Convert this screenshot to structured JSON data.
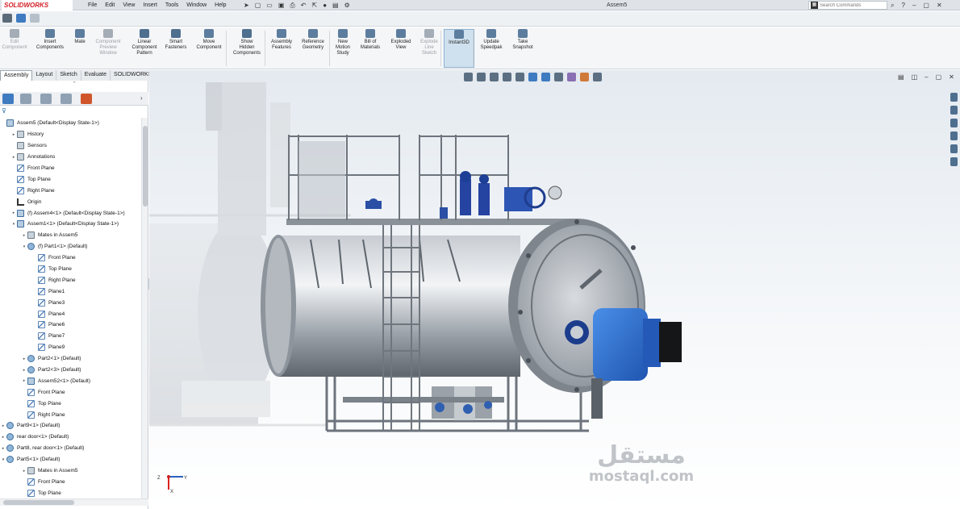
{
  "app": {
    "logo_text": "SOLIDWORKS",
    "window_title": "Assem5",
    "menu": [
      "File",
      "Edit",
      "View",
      "Insert",
      "Tools",
      "Window",
      "Help"
    ],
    "search_placeholder": "Search Commands"
  },
  "ribbon": {
    "buttons": [
      {
        "label": "Edit\nComponent",
        "enabled": false
      },
      {
        "label": "Insert\nComponents",
        "enabled": true
      },
      {
        "label": "Mate",
        "enabled": true
      },
      {
        "label": "Component\nPreview\nWindow",
        "enabled": false
      },
      {
        "label": "Linear\nComponent\nPattern",
        "enabled": true
      },
      {
        "label": "Smart\nFasteners",
        "enabled": true
      },
      {
        "label": "Move\nComponent",
        "enabled": true
      },
      {
        "label": "Show\nHidden\nComponents",
        "enabled": true
      },
      {
        "label": "Assembly\nFeatures",
        "enabled": true
      },
      {
        "label": "Reference\nGeometry",
        "enabled": true
      },
      {
        "label": "New\nMotion\nStudy",
        "enabled": true
      },
      {
        "label": "Bill of\nMaterials",
        "enabled": true
      },
      {
        "label": "Exploded\nView",
        "enabled": true
      },
      {
        "label": "Explode\nLine\nSketch",
        "enabled": false
      },
      {
        "label": "Instant3D",
        "enabled": true,
        "active": true
      },
      {
        "label": "Update\nSpeedpak",
        "enabled": true
      },
      {
        "label": "Take\nSnapshot",
        "enabled": true
      }
    ]
  },
  "tabs": [
    "Assembly",
    "Layout",
    "Sketch",
    "Evaluate",
    "SOLIDWORKS Add-Ins",
    "SOLIDWORKS MBD"
  ],
  "active_tab": "Assembly",
  "tree": [
    {
      "label": "Assem5  (Default<Display State-1>)",
      "icon": "assem",
      "indent": 0,
      "expander": ""
    },
    {
      "label": "History",
      "icon": "folder",
      "indent": 1,
      "expander": "▸"
    },
    {
      "label": "Sensors",
      "icon": "folder",
      "indent": 1,
      "expander": ""
    },
    {
      "label": "Annotations",
      "icon": "folder",
      "indent": 1,
      "expander": "▸"
    },
    {
      "label": "Front Plane",
      "icon": "plane",
      "indent": 1,
      "expander": ""
    },
    {
      "label": "Top Plane",
      "icon": "plane",
      "indent": 1,
      "expander": ""
    },
    {
      "label": "Right Plane",
      "icon": "plane",
      "indent": 1,
      "expander": ""
    },
    {
      "label": "Origin",
      "icon": "origin",
      "indent": 1,
      "expander": ""
    },
    {
      "label": "(f) Assem4<1> (Default<Display State-1>)",
      "icon": "assem",
      "indent": 1,
      "expander": "▸"
    },
    {
      "label": "Assem1<1> (Default<Display State-1>)",
      "icon": "assem",
      "indent": 1,
      "expander": "▾"
    },
    {
      "label": "Mates in Assem5",
      "icon": "folder",
      "indent": 2,
      "expander": "▸"
    },
    {
      "label": "(f) Part1<1> (Default)",
      "icon": "part",
      "indent": 2,
      "expander": "▾"
    },
    {
      "label": "Front Plane",
      "icon": "plane",
      "indent": 3,
      "expander": ""
    },
    {
      "label": "Top Plane",
      "icon": "plane",
      "indent": 3,
      "expander": ""
    },
    {
      "label": "Right Plane",
      "icon": "plane",
      "indent": 3,
      "expander": ""
    },
    {
      "label": "Plane1",
      "icon": "plane",
      "indent": 3,
      "expander": ""
    },
    {
      "label": "Plane3",
      "icon": "plane",
      "indent": 3,
      "expander": ""
    },
    {
      "label": "Plane4",
      "icon": "plane",
      "indent": 3,
      "expander": ""
    },
    {
      "label": "Plane6",
      "icon": "plane",
      "indent": 3,
      "expander": ""
    },
    {
      "label": "Plane7",
      "icon": "plane",
      "indent": 3,
      "expander": ""
    },
    {
      "label": "Plane9",
      "icon": "plane",
      "indent": 3,
      "expander": ""
    },
    {
      "label": "Part2<1> (Default)",
      "icon": "part",
      "indent": 2,
      "expander": "▸"
    },
    {
      "label": "Part2<3> (Default)",
      "icon": "part",
      "indent": 2,
      "expander": "▸"
    },
    {
      "label": "Assem52<1> (Default)",
      "icon": "assem",
      "indent": 2,
      "expander": "▸"
    },
    {
      "label": "Front Plane",
      "icon": "plane",
      "indent": 2,
      "expander": ""
    },
    {
      "label": "Top Plane",
      "icon": "plane",
      "indent": 2,
      "expander": ""
    },
    {
      "label": "Right Plane",
      "icon": "plane",
      "indent": 2,
      "expander": ""
    },
    {
      "label": "Part9<1> (Default)",
      "icon": "part",
      "indent": 0,
      "expander": "▸"
    },
    {
      "label": "rear door<1> (Default)",
      "icon": "part",
      "indent": 0,
      "expander": "▸"
    },
    {
      "label": "Part8, rear door<1> (Default)",
      "icon": "part",
      "indent": 0,
      "expander": "▸"
    },
    {
      "label": "Part5<1> (Default)",
      "icon": "part",
      "indent": 0,
      "expander": "▾"
    },
    {
      "label": "Mates in Assem5",
      "icon": "folder",
      "indent": 2,
      "expander": "▸"
    },
    {
      "label": "Front Plane",
      "icon": "plane",
      "indent": 2,
      "expander": ""
    },
    {
      "label": "Top Plane",
      "icon": "plane",
      "indent": 2,
      "expander": ""
    }
  ],
  "watermark": {
    "arabic": "مستقل",
    "latin": "mostaql.com"
  },
  "colors": {
    "accent": "#2a6fb0",
    "burner_blue": "#2f6fd0",
    "boiler_gray": "#9aa3ad"
  }
}
